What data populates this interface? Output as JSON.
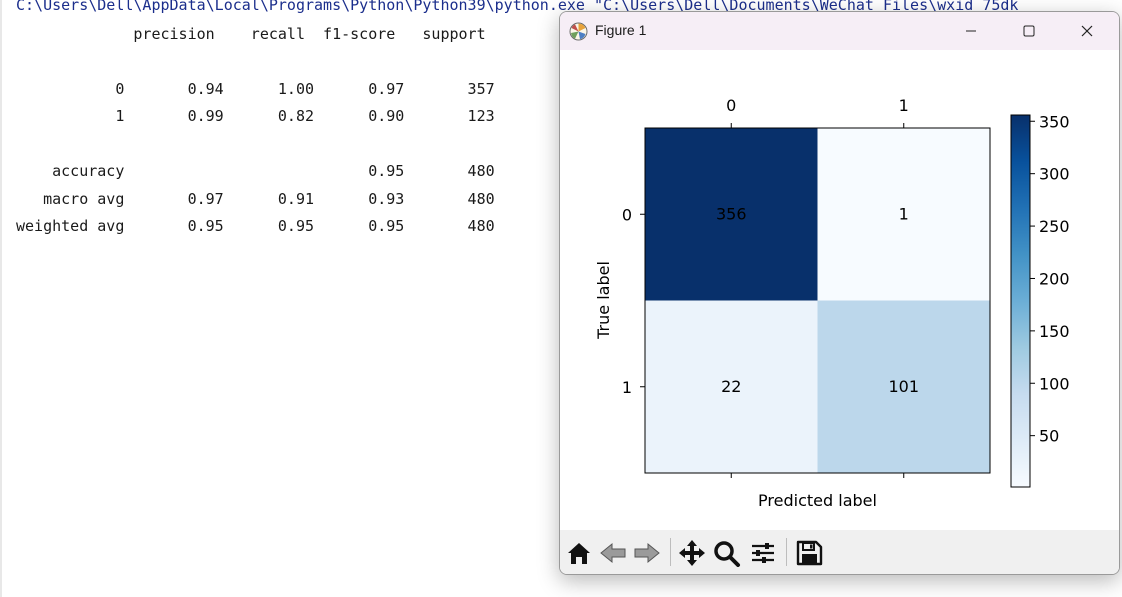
{
  "console": {
    "command_line": "C:\\Users\\Dell\\AppData\\Local\\Programs\\Python\\Python39\\python.exe \"C:\\Users\\Dell\\Documents\\WeChat Files\\wxid_75dk",
    "report_lines": [
      "             precision    recall  f1-score   support",
      "",
      "           0       0.94      1.00      0.97       357",
      "           1       0.99      0.82      0.90       123",
      "",
      "    accuracy                           0.95       480",
      "   macro avg       0.97      0.91      0.93       480",
      "weighted avg       0.95      0.95      0.95       480"
    ]
  },
  "window": {
    "title": "Figure 1",
    "icons": {
      "app": "matplotlib-figure-icon",
      "minimize": "minimize-icon",
      "maximize": "maximize-icon",
      "close": "close-icon"
    }
  },
  "toolbar": {
    "buttons": [
      {
        "icon": "home-icon"
      },
      {
        "icon": "back-arrow-icon"
      },
      {
        "icon": "forward-arrow-icon"
      },
      {
        "icon": "pan-move-icon"
      },
      {
        "icon": "zoom-magnifier-icon"
      },
      {
        "icon": "configure-subplots-icon"
      },
      {
        "icon": "save-figure-icon"
      }
    ]
  },
  "chart_data": {
    "type": "heatmap",
    "x_categories": [
      "0",
      "1"
    ],
    "y_categories": [
      "0",
      "1"
    ],
    "values": [
      [
        356,
        1
      ],
      [
        22,
        101
      ]
    ],
    "xlabel": "Predicted label",
    "ylabel": "True label",
    "colormap": "Blues",
    "x_tick_position": "top",
    "colorbar": {
      "ticks": [
        50,
        100,
        150,
        200,
        250,
        300,
        350
      ],
      "tick_labels": [
        "50",
        "100",
        "150",
        "200",
        "250",
        "300",
        "350"
      ],
      "range": [
        1,
        356
      ]
    },
    "grid": false
  }
}
